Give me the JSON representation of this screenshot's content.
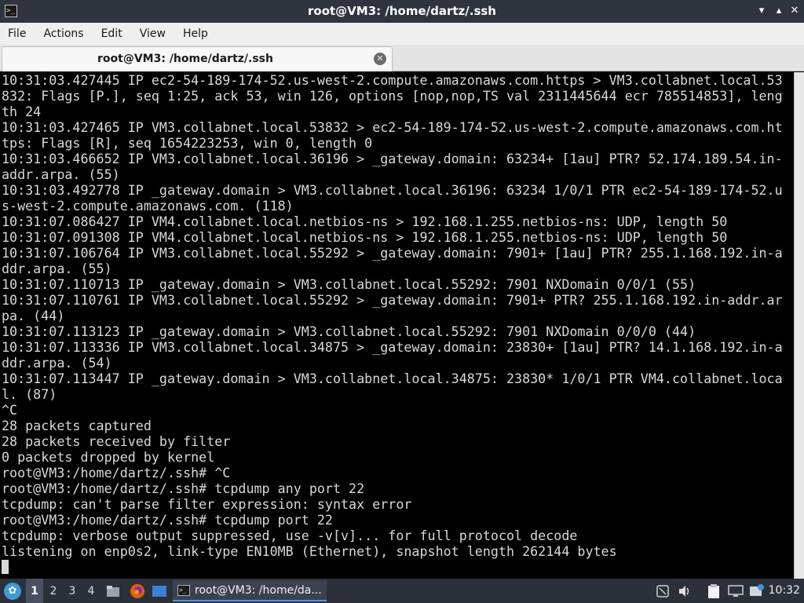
{
  "window": {
    "title": "root@VM3: /home/dartz/.ssh",
    "minimize_glyph": "▾",
    "maximize_glyph": "▴",
    "close_glyph": "✕",
    "app_icon_glyph": ">_"
  },
  "menu": {
    "items": [
      "File",
      "Actions",
      "Edit",
      "View",
      "Help"
    ]
  },
  "tabs": [
    {
      "label": "root@VM3: /home/dartz/.ssh",
      "close_glyph": "✕"
    }
  ],
  "terminal": {
    "lines": [
      "10:31:03.427445 IP ec2-54-189-174-52.us-west-2.compute.amazonaws.com.https > VM3.collabnet.local.53",
      "832: Flags [P.], seq 1:25, ack 53, win 126, options [nop,nop,TS val 2311445644 ecr 785514853], leng",
      "th 24",
      "10:31:03.427465 IP VM3.collabnet.local.53832 > ec2-54-189-174-52.us-west-2.compute.amazonaws.com.ht",
      "tps: Flags [R], seq 1654223253, win 0, length 0",
      "10:31:03.466652 IP VM3.collabnet.local.36196 > _gateway.domain: 63234+ [1au] PTR? 52.174.189.54.in-",
      "addr.arpa. (55)",
      "10:31:03.492778 IP _gateway.domain > VM3.collabnet.local.36196: 63234 1/0/1 PTR ec2-54-189-174-52.u",
      "s-west-2.compute.amazonaws.com. (118)",
      "10:31:07.086427 IP VM4.collabnet.local.netbios-ns > 192.168.1.255.netbios-ns: UDP, length 50",
      "10:31:07.091308 IP VM4.collabnet.local.netbios-ns > 192.168.1.255.netbios-ns: UDP, length 50",
      "10:31:07.106764 IP VM3.collabnet.local.55292 > _gateway.domain: 7901+ [1au] PTR? 255.1.168.192.in-a",
      "ddr.arpa. (55)",
      "10:31:07.110713 IP _gateway.domain > VM3.collabnet.local.55292: 7901 NXDomain 0/0/1 (55)",
      "10:31:07.110761 IP VM3.collabnet.local.55292 > _gateway.domain: 7901+ PTR? 255.1.168.192.in-addr.ar",
      "pa. (44)",
      "10:31:07.113123 IP _gateway.domain > VM3.collabnet.local.55292: 7901 NXDomain 0/0/0 (44)",
      "10:31:07.113336 IP VM3.collabnet.local.34875 > _gateway.domain: 23830+ [1au] PTR? 14.1.168.192.in-a",
      "ddr.arpa. (54)",
      "10:31:07.113447 IP _gateway.domain > VM3.collabnet.local.34875: 23830* 1/0/1 PTR VM4.collabnet.loca",
      "l. (87)",
      "^C",
      "28 packets captured",
      "28 packets received by filter",
      "0 packets dropped by kernel",
      "root@VM3:/home/dartz/.ssh# ^C",
      "root@VM3:/home/dartz/.ssh# tcpdump any port 22",
      "tcpdump: can't parse filter expression: syntax error",
      "root@VM3:/home/dartz/.ssh# tcpdump port 22",
      "tcpdump: verbose output suppressed, use -v[v]... for full protocol decode",
      "listening on enp0s2, link-type EN10MB (Ethernet), snapshot length 262144 bytes"
    ]
  },
  "taskbar": {
    "workspaces": [
      "1",
      "2",
      "3",
      "4"
    ],
    "active_workspace": "1",
    "task_label": "root@VM3: /home/da...",
    "clock": "10:32"
  }
}
